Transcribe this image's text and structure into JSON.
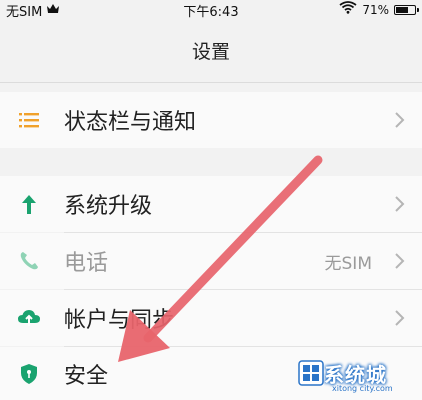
{
  "status_bar": {
    "carrier": "无SIM",
    "time": "下午6:43",
    "battery_pct_text": "71%",
    "battery_level": 0.71
  },
  "header": {
    "title": "设置"
  },
  "rows": [
    {
      "label": "状态栏与通知",
      "icon": "list-icon",
      "color": "#f0a12b"
    },
    {
      "label": "系统升级",
      "icon": "arrow-up-icon",
      "color": "#1aa36f"
    },
    {
      "label": "电话",
      "icon": "phone-icon",
      "color": "#8fd3b5",
      "value": "无SIM",
      "disabled": true
    },
    {
      "label": "帐户与同步",
      "icon": "cloud-sync-icon",
      "color": "#1aa36f"
    },
    {
      "label": "安全",
      "icon": "shield-icon",
      "color": "#1aa36f"
    }
  ],
  "annotation": {
    "color": "#e8646c"
  },
  "watermark": {
    "text": "系统城",
    "subtext": "xitong city.com"
  }
}
